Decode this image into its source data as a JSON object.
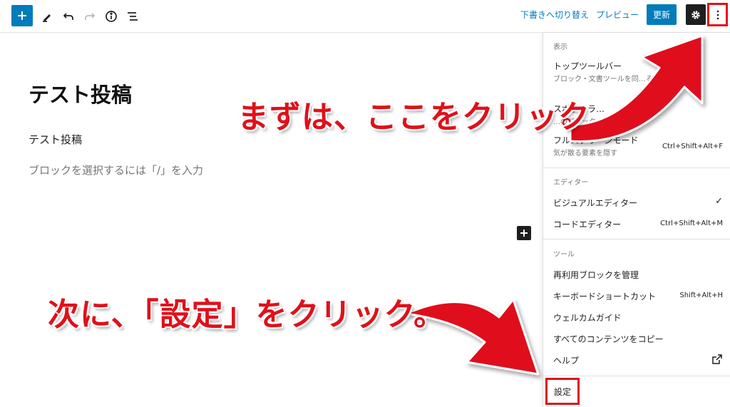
{
  "toolbar": {
    "switch_to_draft": "下書きへ切り替え",
    "preview": "プレビュー",
    "update": "更新"
  },
  "editor": {
    "post_title": "テスト投稿",
    "paragraph": "テスト投稿",
    "block_placeholder": "ブロックを選択するには「/」を入力"
  },
  "menu": {
    "view_heading": "表示",
    "top_toolbar_label": "トップツールバー",
    "top_toolbar_desc": "ブロック・文書ツールを同…る",
    "spotlight_label": "スポットラ…",
    "spotlight_desc": "…のブロック…",
    "fullscreen_label": "フルスクリーンモード",
    "fullscreen_desc": "気が散る要素を隠す",
    "fullscreen_shortcut": "Ctrl+Shift+Alt+F",
    "editor_heading": "エディター",
    "visual_editor_label": "ビジュアルエディター",
    "visual_editor_check": "✓",
    "code_editor_label": "コードエディター",
    "code_editor_shortcut": "Ctrl+Shift+Alt+M",
    "tools_heading": "ツール",
    "manage_reusable": "再利用ブロックを管理",
    "keyboard_shortcuts": "キーボードショートカット",
    "keyboard_shortcuts_key": "Shift+Alt+H",
    "welcome_guide": "ウェルカムガイド",
    "copy_all": "すべてのコンテンツをコピー",
    "help": "ヘルプ",
    "settings": "設定"
  },
  "annotations": {
    "first": "まずは、ここをクリック",
    "second": "次に、「設定」をクリック。",
    "color": "#e0101a"
  },
  "icons": [
    "plus-icon",
    "pencil-icon",
    "undo-icon",
    "redo-icon",
    "info-icon",
    "list-view-icon",
    "gear-icon",
    "more-vertical-icon",
    "external-link-icon"
  ]
}
